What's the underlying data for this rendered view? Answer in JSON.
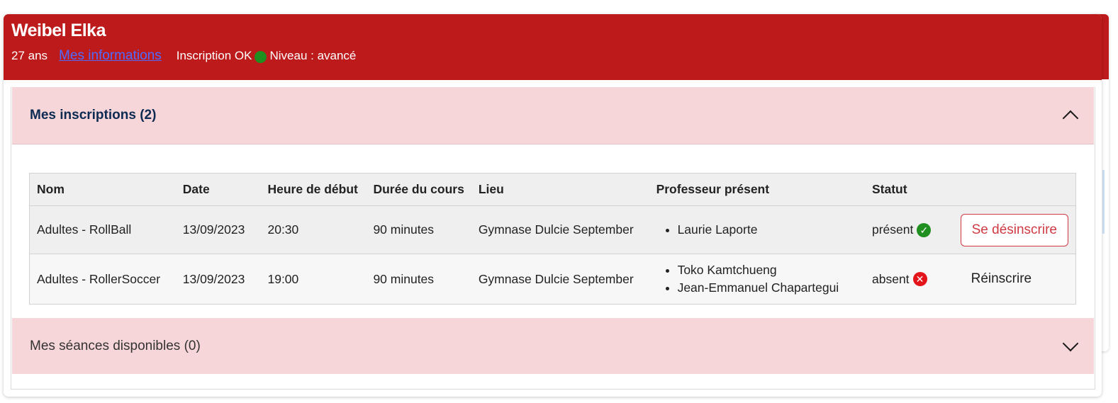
{
  "profile": {
    "name": "Weibel Elka",
    "age": "27 ans",
    "info_link": "Mes informations",
    "registration_status": "Inscription OK",
    "level": "Niveau : avancé"
  },
  "inscriptions": {
    "title": "Mes inscriptions (2)",
    "expanded": true,
    "columns": [
      "Nom",
      "Date",
      "Heure de début",
      "Durée du cours",
      "Lieu",
      "Professeur présent",
      "Statut"
    ],
    "rows": [
      {
        "nom": "Adultes - RollBall",
        "date": "13/09/2023",
        "heure": "20:30",
        "duree": "90 minutes",
        "lieu": "Gymnase Dulcie September",
        "professeurs": [
          "Laurie Laporte"
        ],
        "statut": "présent",
        "statut_icon": "check-circle-icon",
        "action": "Se désinscrire"
      },
      {
        "nom": "Adultes - RollerSoccer",
        "date": "13/09/2023",
        "heure": "19:00",
        "duree": "90 minutes",
        "lieu": "Gymnase Dulcie September",
        "professeurs": [
          "Toko Kamtchueng",
          "Jean-Emmanuel Chapartegui"
        ],
        "statut": "absent",
        "statut_icon": "x-circle-icon",
        "action": "Réinscrire"
      }
    ]
  },
  "seances": {
    "title": "Mes séances disponibles (0)",
    "expanded": false
  },
  "colors": {
    "header_red": "#bd1a1b",
    "accordion_pink": "#f7d6d9",
    "link_blue": "#4f6bff",
    "ok_green": "#1f8f1f",
    "error_red": "#e4151a",
    "button_red": "#d03a44"
  }
}
